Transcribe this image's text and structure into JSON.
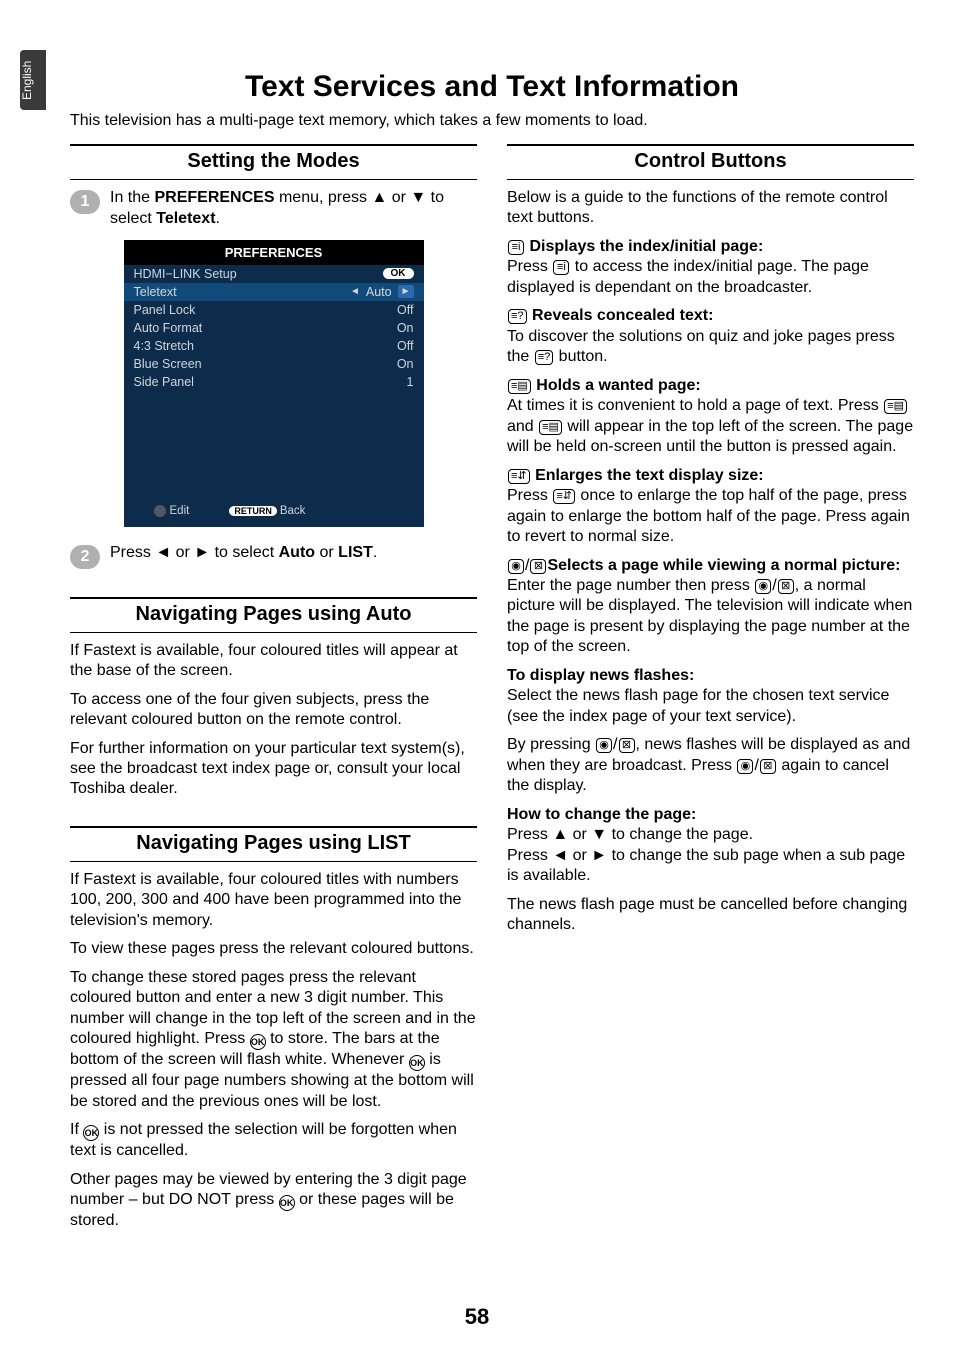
{
  "langTab": "English",
  "title": "Text Services and Text Information",
  "intro": "This television has a multi-page text memory, which takes a few moments to load.",
  "pageNumber": "58",
  "left": {
    "setting": {
      "heading": "Setting the Modes",
      "step1_pre": "In the ",
      "step1_b1": "PREFERENCES",
      "step1_mid": " menu, press ▲ or ▼ to select ",
      "step1_b2": "Teletext",
      "step1_end": ".",
      "step2_pre": "Press ◄ or ► to select ",
      "step2_b1": "Auto",
      "step2_mid": " or ",
      "step2_b2": "LIST",
      "step2_end": ".",
      "badge1": "1",
      "badge2": "2"
    },
    "osd": {
      "title": "PREFERENCES",
      "okLabel": "OK",
      "rows": [
        {
          "label": "HDMI−LINK Setup",
          "value": ""
        },
        {
          "label": "Teletext",
          "value": "Auto",
          "selected": true
        },
        {
          "label": "Panel Lock",
          "value": "Off"
        },
        {
          "label": "Auto Format",
          "value": "On"
        },
        {
          "label": "4:3 Stretch",
          "value": "Off"
        },
        {
          "label": "Blue Screen",
          "value": "On"
        },
        {
          "label": "Side Panel",
          "value": "1"
        }
      ],
      "footerEdit": "Edit",
      "footerReturn": "RETURN",
      "footerBack": "Back"
    },
    "auto": {
      "heading": "Navigating Pages using Auto",
      "p1": "If Fastext is available, four coloured titles will appear at the base of the screen.",
      "p2": "To access one of the four given subjects, press the relevant coloured button on the remote control.",
      "p3": "For further information on your particular text system(s), see the broadcast text index page or, consult your local Toshiba dealer."
    },
    "list": {
      "heading": "Navigating Pages using LIST",
      "p1": "If Fastext is available, four coloured titles with numbers 100, 200, 300 and 400 have been programmed into the television's memory.",
      "p2": "To view these pages press the relevant coloured buttons.",
      "p3a": "To change these stored pages press the relevant coloured button and enter a new 3 digit number. This number will change in the top left of the screen and in the coloured highlight. Press ",
      "p3b": " to store. The bars at the bottom of the screen will flash white. Whenever ",
      "p3c": " is pressed all four page numbers showing at the bottom will be stored and the previous ones will be lost.",
      "p4a": "If ",
      "p4b": " is not pressed the selection will be forgotten when text is cancelled.",
      "p5a": "Other pages may be viewed by entering the 3 digit page number – but DO NOT press ",
      "p5b": " or these pages will be stored."
    }
  },
  "right": {
    "heading": "Control Buttons",
    "intro": "Below is a guide to the functions of the remote control text buttons.",
    "s1": {
      "glyph": "≡i",
      "title": " Displays the index/initial page:",
      "body_a": "Press ",
      "body_b": " to access the index/initial page. The page displayed is dependant on the broadcaster."
    },
    "s2": {
      "glyph": "≡?",
      "title": " Reveals concealed text:",
      "body_a": "To discover the solutions on quiz and joke pages press the ",
      "body_b": " button."
    },
    "s3": {
      "glyph": "≡▤",
      "title": " Holds a wanted page:",
      "body_a": "At times it is convenient to hold a page of text. Press ",
      "body_b": " and ",
      "body_c": " will appear in the top left of the screen. The page will be held on-screen until the button is pressed again."
    },
    "s4": {
      "glyph": "≡⇵",
      "title": " Enlarges the text display size:",
      "body": "Press ",
      "body_b": " once to enlarge the top half of the page, press again to enlarge the bottom half of the page. Press again to revert to normal size."
    },
    "s5": {
      "glyph1": "◉",
      "glyph2": "⊠",
      "title": "Selects a page while viewing a normal picture:",
      "body_a": "Enter the page number then press ",
      "body_b": ", a normal picture will be displayed. The television will indicate when the page is present by displaying the page number at the top of the screen."
    },
    "s6": {
      "title": "To display news flashes:",
      "p1": "Select the news flash page for the chosen text service (see the index page of your text service).",
      "p2a": "By pressing ",
      "p2b": ", news flashes will be displayed as and when they are broadcast. Press ",
      "p2c": " again to cancel the display."
    },
    "s7": {
      "title": "How to change the page:",
      "p1": "Press ▲ or ▼ to change the page.",
      "p2": "Press ◄ or ► to change the sub page when a sub page is available.",
      "p3": "The news flash page must be cancelled before changing channels."
    }
  }
}
